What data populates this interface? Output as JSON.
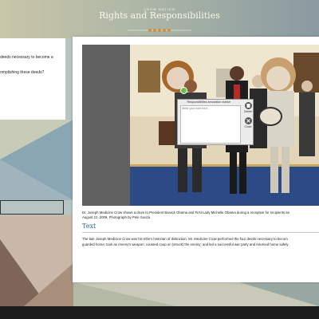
{
  "header": {
    "kicker": "CROW NATION",
    "title": "Rights and Responsibilities"
  },
  "left_card": {
    "line1": "deeds necessary to become a",
    "line2": "omplishing these deeds?"
  },
  "annotation": {
    "header": "Responsibilities annotation marker",
    "placeholder": "Write your note here...",
    "delete_label": "Delete",
    "close_label": "Close"
  },
  "caption": {
    "line1": "Dr. Joseph Medicine Crow shows a drum to President Barack Obama and First Lady Michelle Obama during a reception for recipients an",
    "line2": "August 12, 2009. Photograph by Pete Souza"
  },
  "section": {
    "title": "Text"
  },
  "body_text": {
    "line1": "The late Joseph Medicine Crow was his tribe's historian of distinction. Mr. Medicine Crow performed the four deeds necessary to becom",
    "line2": "guarded horse; took an enemy's weapon; counted coup on (struck) the enemy; and led a successful war party and returned home safely"
  },
  "colors": {
    "accent_blue": "#2a6a99",
    "pin_green": "#6cc04a",
    "footer": "#1c1c1c"
  }
}
